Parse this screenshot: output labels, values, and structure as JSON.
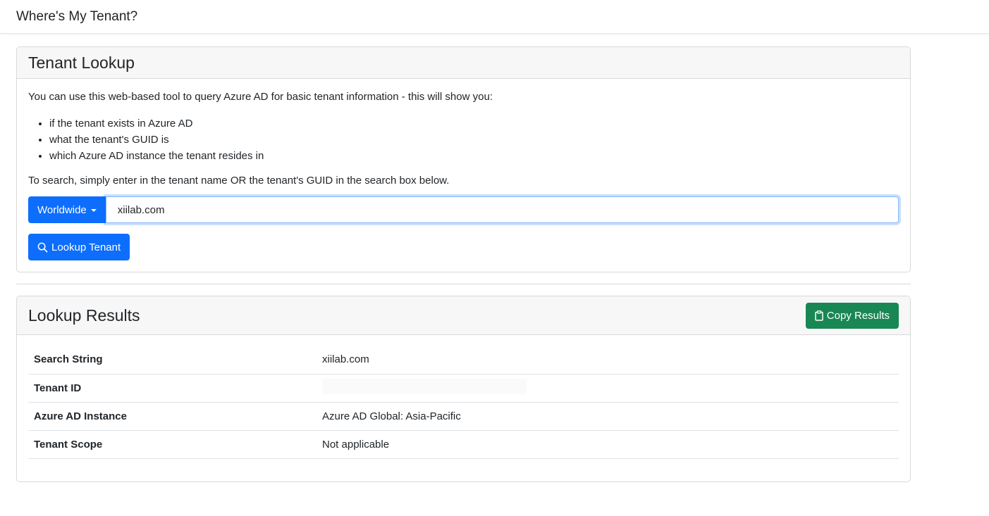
{
  "navbar": {
    "title": "Where's My Tenant?"
  },
  "lookup": {
    "title": "Tenant Lookup",
    "intro": "You can use this web-based tool to query Azure AD for basic tenant information - this will show you:",
    "bullets": [
      "if the tenant exists in Azure AD",
      "what the tenant's GUID is",
      "which Azure AD instance the tenant resides in"
    ],
    "instructions": "To search, simply enter in the tenant name OR the tenant's GUID in the search box below.",
    "dropdown_label": "Worldwide",
    "search_value": "xiilab.com",
    "lookup_button": "Lookup Tenant"
  },
  "results": {
    "title": "Lookup Results",
    "copy_button": "Copy Results",
    "rows": [
      {
        "key": "Search String",
        "value": "xiilab.com"
      },
      {
        "key": "Tenant ID",
        "value": ""
      },
      {
        "key": "Azure AD Instance",
        "value": "Azure AD Global: Asia-Pacific"
      },
      {
        "key": "Tenant Scope",
        "value": "Not applicable"
      }
    ]
  },
  "colors": {
    "primary": "#0d6efd",
    "success": "#198754"
  },
  "icons": {
    "lookup_button": "search-icon",
    "copy_button": "clipboard-icon",
    "dropdown": "caret-down-icon"
  }
}
